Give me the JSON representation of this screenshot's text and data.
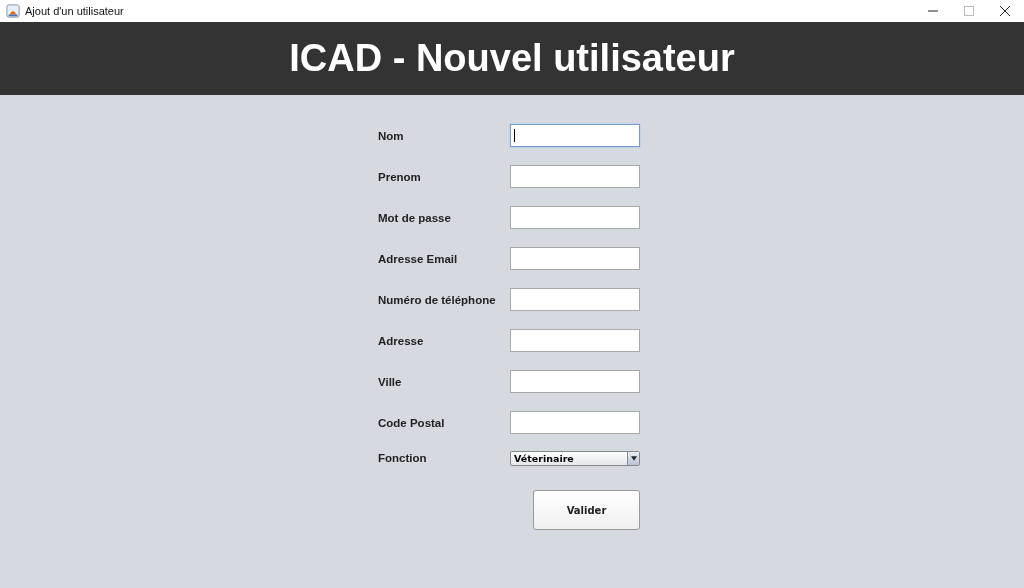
{
  "window": {
    "title": "Ajout d'un utilisateur"
  },
  "header": {
    "title": "ICAD - Nouvel utilisateur"
  },
  "fields": [
    {
      "kind": "text",
      "label": "Nom",
      "focused": true
    },
    {
      "kind": "text",
      "label": "Prenom",
      "focused": false
    },
    {
      "kind": "text",
      "label": "Mot de passe",
      "focused": false
    },
    {
      "kind": "text",
      "label": "Adresse Email",
      "focused": false
    },
    {
      "kind": "text",
      "label": "Numéro de téléphone",
      "focused": false
    },
    {
      "kind": "text",
      "label": "Adresse",
      "focused": false
    },
    {
      "kind": "text",
      "label": "Ville",
      "focused": false
    },
    {
      "kind": "text",
      "label": "Code Postal",
      "focused": false
    },
    {
      "kind": "select",
      "label": "Fonction",
      "value": "Véterinaire"
    }
  ],
  "submit": {
    "label": "Valider"
  }
}
